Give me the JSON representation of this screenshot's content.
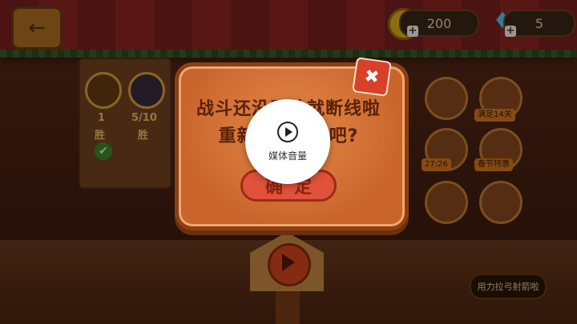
{
  "hud": {
    "back_icon": "arrow-left-icon",
    "coins": "200",
    "gems": "5",
    "coin_symbol": "$",
    "plus": "+"
  },
  "side_panel": {
    "count_a": "1",
    "count_b": "5/10",
    "label_a": "胜",
    "label_b": "胜"
  },
  "slots": {
    "tag_1": "满足14关",
    "timer": "27:26",
    "tag_2": "春节特惠"
  },
  "hint": {
    "text": "用力拉弓射箭啦"
  },
  "dialog": {
    "message_line1": "战斗还没开始就断线啦",
    "message_line2": "重新连接试试吧?",
    "confirm": "确定",
    "close_symbol": "✖"
  },
  "media_popup": {
    "label": "媒体音量",
    "icon": "play-circle-icon"
  },
  "colors": {
    "dialog": "#d7763a",
    "button": "#e0523a",
    "overlay": "rgba(0,0,0,0.38)"
  }
}
